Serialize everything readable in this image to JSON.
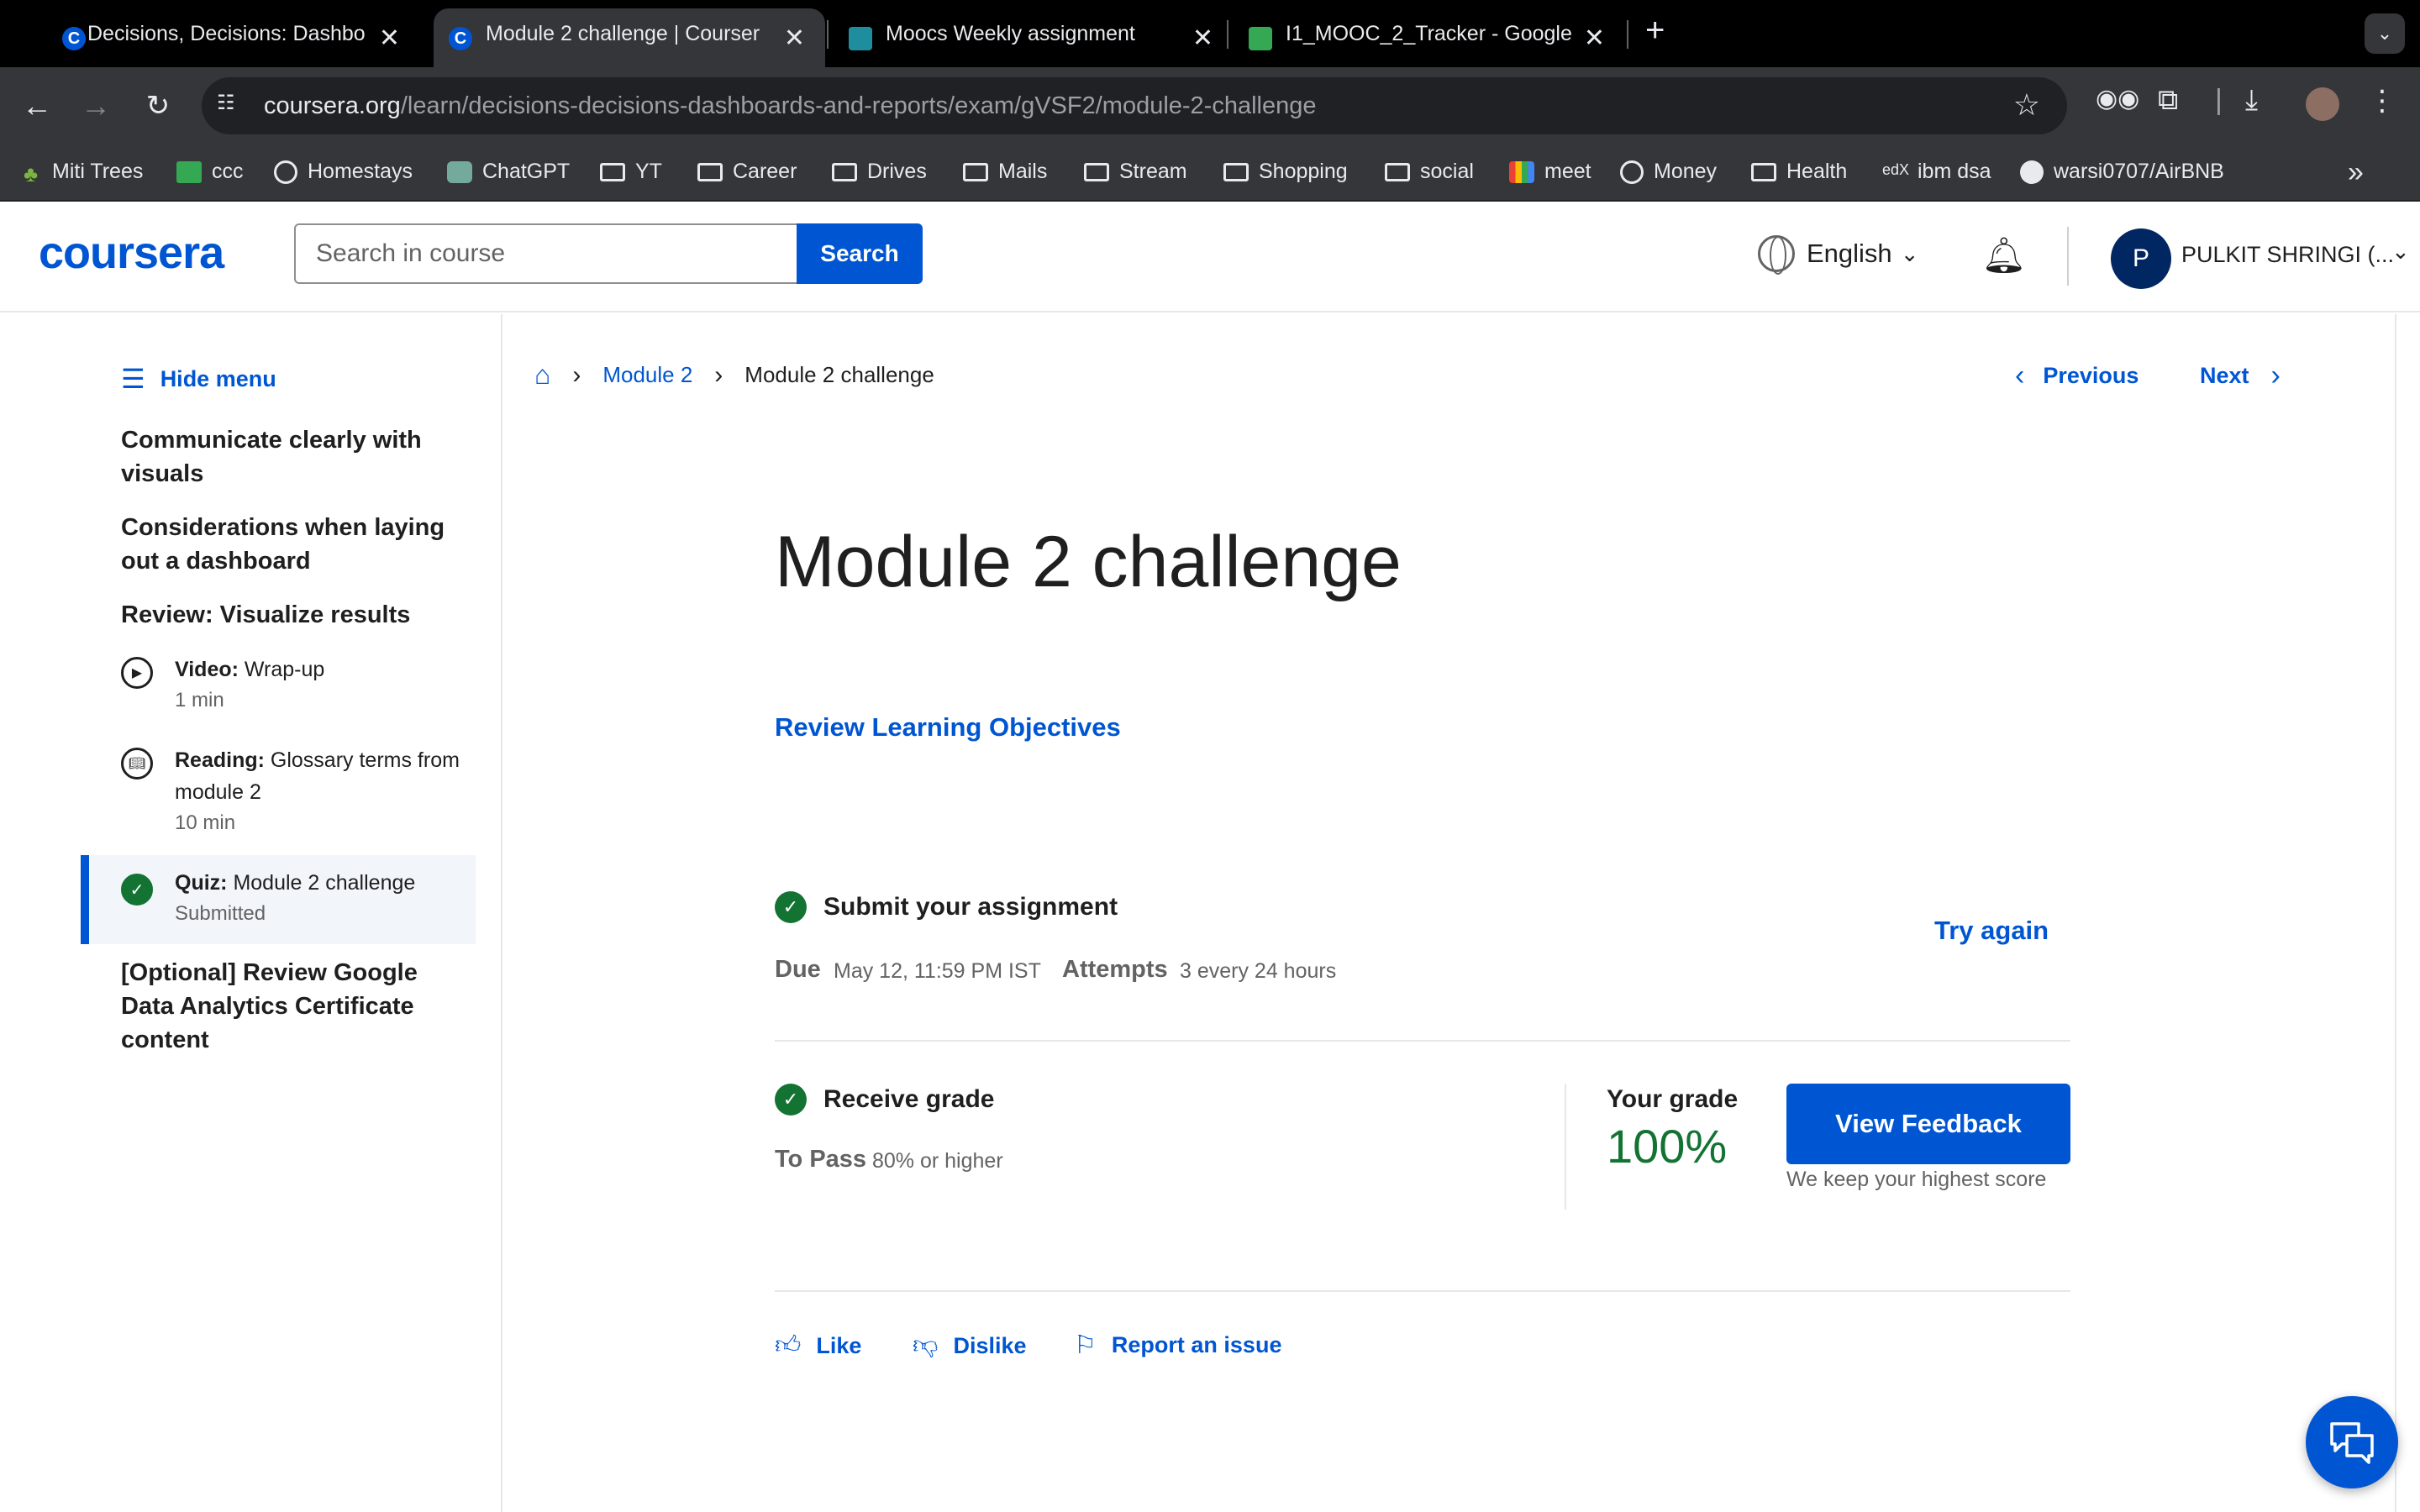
{
  "browser": {
    "tabs": [
      {
        "title": "Decisions, Decisions: Dashbo",
        "favicon": "coursera-icon",
        "active": false
      },
      {
        "title": "Module 2 challenge | Courser",
        "favicon": "coursera-icon",
        "active": true
      },
      {
        "title": "Moocs Weekly assignment",
        "favicon": "classroom-icon",
        "active": false
      },
      {
        "title": "I1_MOOC_2_Tracker - Google",
        "favicon": "sheets-icon",
        "active": false
      }
    ],
    "url_host": "coursera.org",
    "url_path": "/learn/decisions-decisions-dashboards-and-reports/exam/gVSF2/module-2-challenge",
    "bookmarks": [
      {
        "label": "Miti Trees",
        "icon": "palm-icon"
      },
      {
        "label": "ccc",
        "icon": "sheets-icon"
      },
      {
        "label": "Homestays",
        "icon": "globe-icon"
      },
      {
        "label": "ChatGPT",
        "icon": "chatgpt-icon"
      },
      {
        "label": "YT",
        "icon": "folder-icon"
      },
      {
        "label": "Career",
        "icon": "folder-icon"
      },
      {
        "label": "Drives",
        "icon": "folder-icon"
      },
      {
        "label": "Mails",
        "icon": "folder-icon"
      },
      {
        "label": "Stream",
        "icon": "folder-icon"
      },
      {
        "label": "Shopping",
        "icon": "folder-icon"
      },
      {
        "label": "social",
        "icon": "folder-icon"
      },
      {
        "label": "meet",
        "icon": "meet-icon"
      },
      {
        "label": "Money",
        "icon": "globe-icon"
      },
      {
        "label": "Health",
        "icon": "folder-icon"
      },
      {
        "label": "ibm dsa",
        "icon": "edx-icon"
      },
      {
        "label": "warsi0707/AirBNB",
        "icon": "github-icon"
      }
    ]
  },
  "header": {
    "logo": "coursera",
    "search_placeholder": "Search in course",
    "search_button": "Search",
    "language": "English",
    "user_initial": "P",
    "user_name": "PULKIT SHRINGI (..."
  },
  "sidebar": {
    "hide_menu": "Hide menu",
    "sections": [
      "Communicate clearly with visuals",
      "Considerations when laying out a dashboard",
      "Review: Visualize results",
      "[Optional] Review Google Data Analytics Certificate content"
    ],
    "items": [
      {
        "type": "Video:",
        "title": "Wrap-up",
        "meta": "1 min",
        "icon": "play-icon"
      },
      {
        "type": "Reading:",
        "title": "Glossary terms from module 2",
        "meta": "10 min",
        "icon": "book-icon"
      },
      {
        "type": "Quiz:",
        "title": "Module 2 challenge",
        "meta": "Submitted",
        "icon": "check-circle-icon"
      }
    ]
  },
  "breadcrumb": {
    "module": "Module 2",
    "current": "Module 2 challenge"
  },
  "nav": {
    "previous": "Previous",
    "next": "Next"
  },
  "main": {
    "title": "Module 2 challenge",
    "review_objectives": "Review Learning Objectives",
    "submit": {
      "title": "Submit your assignment",
      "due_label": "Due",
      "due_value": "May 12, 11:59 PM IST",
      "attempts_label": "Attempts",
      "attempts_value": "3 every 24 hours",
      "try_again": "Try again"
    },
    "grade": {
      "title": "Receive grade",
      "to_pass_label": "To Pass",
      "to_pass_value": "80% or higher",
      "your_grade_label": "Your grade",
      "your_grade_value": "100%",
      "view_feedback": "View Feedback",
      "keep_note": "We keep your highest score"
    },
    "feedback": {
      "like": "Like",
      "dislike": "Dislike",
      "report": "Report an issue"
    }
  },
  "colors": {
    "brand": "#0056d2",
    "success": "#137333"
  }
}
